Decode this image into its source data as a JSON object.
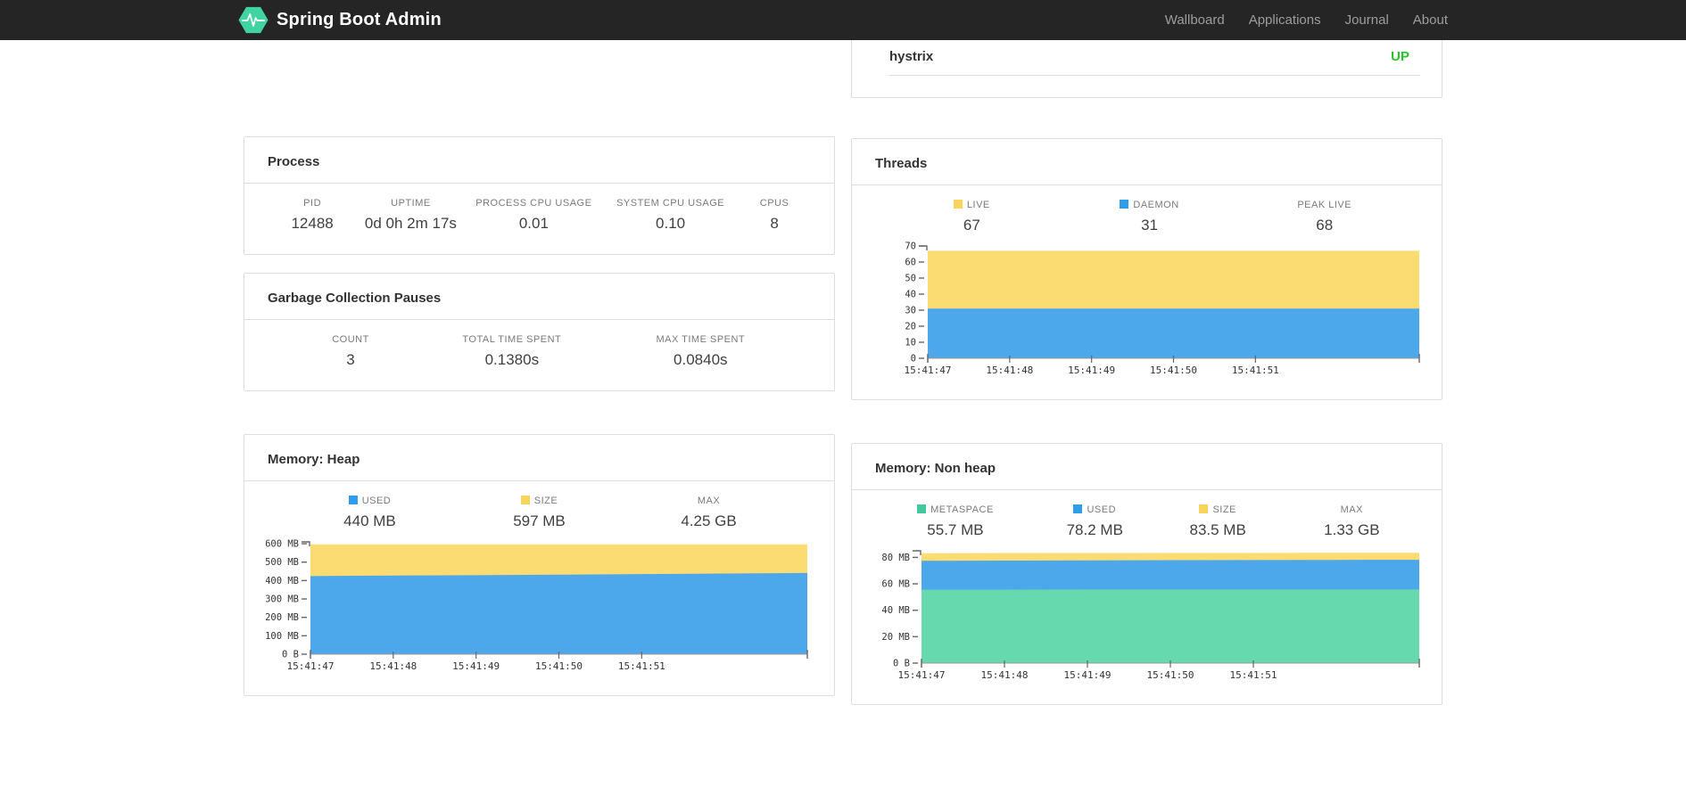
{
  "navbar": {
    "brand": "Spring Boot Admin",
    "items": [
      {
        "label": "Wallboard"
      },
      {
        "label": "Applications"
      },
      {
        "label": "Journal"
      },
      {
        "label": "About"
      }
    ]
  },
  "application_status": {
    "name": "hystrix",
    "status": "UP",
    "status_color": "#28c428"
  },
  "colors": {
    "navbar_bg": "#252525",
    "brand_green": "#41d3a2",
    "chart_yellow": "#fbdc73",
    "chart_blue": "#4ca8ea",
    "chart_green": "#66d9ae",
    "legend_yellow": "#f9d45c",
    "legend_blue": "#2f9de9",
    "legend_green": "#43c89c"
  },
  "cards": {
    "process": {
      "title": "Process",
      "metrics": [
        {
          "label": "PID",
          "value": "12488"
        },
        {
          "label": "UPTIME",
          "value": "0d 0h 2m 17s"
        },
        {
          "label": "PROCESS CPU USAGE",
          "value": "0.01"
        },
        {
          "label": "SYSTEM CPU USAGE",
          "value": "0.10"
        },
        {
          "label": "CPUS",
          "value": "8"
        }
      ]
    },
    "gc": {
      "title": "Garbage Collection Pauses",
      "metrics": [
        {
          "label": "COUNT",
          "value": "3"
        },
        {
          "label": "TOTAL TIME SPENT",
          "value": "0.1380s"
        },
        {
          "label": "MAX TIME SPENT",
          "value": "0.0840s"
        }
      ]
    },
    "threads": {
      "title": "Threads",
      "metrics": [
        {
          "label": "LIVE",
          "value": "67",
          "swatch": "#f9d45c"
        },
        {
          "label": "DAEMON",
          "value": "31",
          "swatch": "#2f9de9"
        },
        {
          "label": "PEAK LIVE",
          "value": "68"
        }
      ]
    },
    "heap": {
      "title": "Memory: Heap",
      "metrics": [
        {
          "label": "USED",
          "value": "440 MB",
          "swatch": "#2f9de9"
        },
        {
          "label": "SIZE",
          "value": "597 MB",
          "swatch": "#f9d45c"
        },
        {
          "label": "MAX",
          "value": "4.25 GB"
        }
      ]
    },
    "nonheap": {
      "title": "Memory: Non heap",
      "metrics": [
        {
          "label": "METASPACE",
          "value": "55.7 MB",
          "swatch": "#43c89c"
        },
        {
          "label": "USED",
          "value": "78.2 MB",
          "swatch": "#2f9de9"
        },
        {
          "label": "SIZE",
          "value": "83.5 MB",
          "swatch": "#f9d45c"
        },
        {
          "label": "MAX",
          "value": "1.33 GB"
        }
      ]
    }
  },
  "chart_data": [
    {
      "type": "area",
      "title": "Threads",
      "legend_position": "top",
      "grid": false,
      "x_labels": [
        "15:41:47",
        "15:41:48",
        "15:41:49",
        "15:41:50",
        "15:41:51"
      ],
      "y_max": 70,
      "y_ticks": [
        {
          "value": 70,
          "label": "70"
        },
        {
          "value": 60,
          "label": "60"
        },
        {
          "value": 50,
          "label": "50"
        },
        {
          "value": 40,
          "label": "40"
        },
        {
          "value": 30,
          "label": "30"
        },
        {
          "value": 20,
          "label": "20"
        },
        {
          "value": 10,
          "label": "10"
        },
        {
          "value": 0,
          "label": "0"
        }
      ],
      "series": [
        {
          "name": "LIVE",
          "color": "#fbdc73",
          "values": [
            67,
            67,
            67,
            67,
            67,
            67,
            67
          ]
        },
        {
          "name": "DAEMON",
          "color": "#4ca8ea",
          "values": [
            31,
            31,
            31,
            31,
            31,
            31,
            31
          ]
        }
      ],
      "layout": {
        "left_pad": 61,
        "right_pad": 3
      }
    },
    {
      "type": "area",
      "title": "Memory: Heap",
      "legend_position": "top",
      "grid": false,
      "x_labels": [
        "15:41:47",
        "15:41:48",
        "15:41:49",
        "15:41:50",
        "15:41:51"
      ],
      "y_max": 610,
      "y_ticks": [
        {
          "value": 600,
          "label": "600 MB"
        },
        {
          "value": 500,
          "label": "500 MB"
        },
        {
          "value": 400,
          "label": "400 MB"
        },
        {
          "value": 300,
          "label": "300 MB"
        },
        {
          "value": 200,
          "label": "200 MB"
        },
        {
          "value": 100,
          "label": "100 MB"
        },
        {
          "value": 0,
          "label": "0 B"
        }
      ],
      "series": [
        {
          "name": "SIZE",
          "color": "#fbdc73",
          "values": [
            597,
            597,
            597,
            597,
            597,
            597,
            597
          ]
        },
        {
          "name": "USED",
          "color": "#4ca8ea",
          "values": [
            424,
            427,
            429,
            432,
            435,
            438,
            441
          ]
        }
      ],
      "layout": {
        "left_pad": 50,
        "right_pad": 8
      }
    },
    {
      "type": "area",
      "title": "Memory: Non heap",
      "legend_position": "top",
      "grid": false,
      "x_labels": [
        "15:41:47",
        "15:41:48",
        "15:41:49",
        "15:41:50",
        "15:41:51"
      ],
      "y_max": 85,
      "y_ticks": [
        {
          "value": 80,
          "label": "80 MB"
        },
        {
          "value": 60,
          "label": "60 MB"
        },
        {
          "value": 40,
          "label": "40 MB"
        },
        {
          "value": 20,
          "label": "20 MB"
        },
        {
          "value": 0,
          "label": "0 B"
        }
      ],
      "series": [
        {
          "name": "SIZE",
          "color": "#fbdc73",
          "values": [
            83.2,
            83.3,
            83.3,
            83.4,
            83.4,
            83.5,
            83.5
          ]
        },
        {
          "name": "USED",
          "color": "#4ca8ea",
          "values": [
            77.4,
            77.6,
            77.7,
            77.9,
            78.0,
            78.1,
            78.2
          ]
        },
        {
          "name": "METASPACE",
          "color": "#66d9ae",
          "values": [
            55.6,
            55.6,
            55.7,
            55.7,
            55.7,
            55.7,
            55.7
          ]
        }
      ],
      "layout": {
        "left_pad": 54,
        "right_pad": 3
      }
    }
  ]
}
